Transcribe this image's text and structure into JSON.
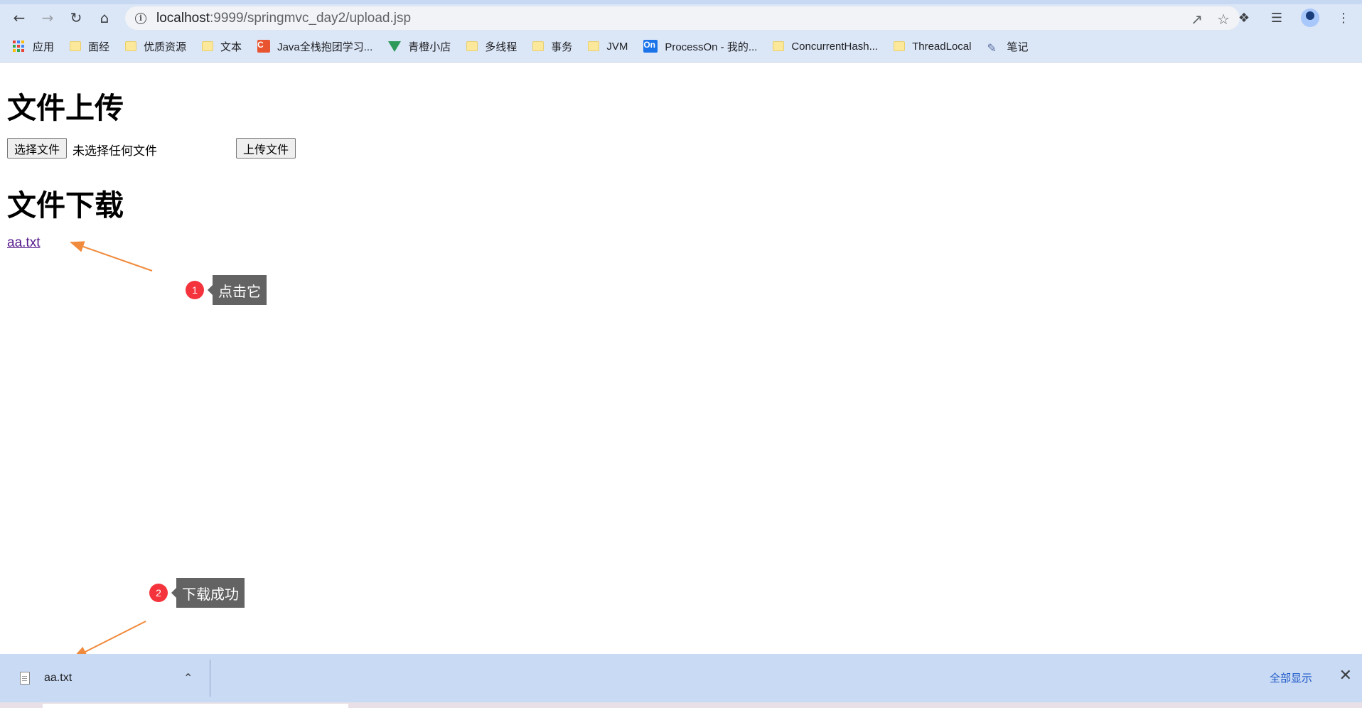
{
  "browser": {
    "url_host": "localhost",
    "url_rest": ":9999/springmvc_day2/upload.jsp",
    "bookmarks": [
      {
        "label": "应用",
        "icon": "apps-grid-icon"
      },
      {
        "label": "面经",
        "icon": "folder-icon"
      },
      {
        "label": "优质资源",
        "icon": "folder-icon"
      },
      {
        "label": "文本",
        "icon": "folder-icon"
      },
      {
        "label": "Java全栈抱团学习...",
        "icon": "csdn-icon"
      },
      {
        "label": "青橙小店",
        "icon": "vue-icon"
      },
      {
        "label": "多线程",
        "icon": "folder-icon"
      },
      {
        "label": "事务",
        "icon": "folder-icon"
      },
      {
        "label": "JVM",
        "icon": "folder-icon"
      },
      {
        "label": "ProcessOn - 我的...",
        "icon": "processon-icon"
      },
      {
        "label": "ConcurrentHash...",
        "icon": "folder-icon"
      },
      {
        "label": "ThreadLocal",
        "icon": "folder-icon"
      },
      {
        "label": "笔记",
        "icon": "pen-icon"
      }
    ],
    "processon_badge": "On",
    "csdn_badge": "C"
  },
  "page": {
    "upload_heading": "文件上传",
    "choose_button": "选择文件",
    "no_file_text": "未选择任何文件",
    "upload_button": "上传文件",
    "download_heading": "文件下载",
    "download_link": "aa.txt"
  },
  "annotations": [
    {
      "number": "1",
      "text": "点击它"
    },
    {
      "number": "2",
      "text": "下载成功"
    }
  ],
  "download_bar": {
    "file_name": "aa.txt",
    "show_all": "全部显示"
  },
  "colors": {
    "badge": "#f4333c",
    "tooltip": "#636363",
    "arrow": "#f08a3c",
    "link_visited": "#551a8b"
  }
}
